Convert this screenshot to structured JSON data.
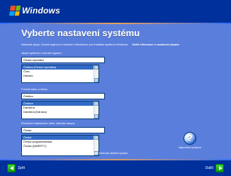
{
  "header": {
    "logo_text": "Windows"
  },
  "page": {
    "title": "Vyberte nastavení systému",
    "intro": "Nastavte jazyk, formát regionu a rozložení klávesnice pro instalaci systému Windows.",
    "intro_link": "Další informace o nastavení jazyka"
  },
  "sections": [
    {
      "label": "Jazyk systému a formát regionu:",
      "selected_value": "Česká republika",
      "list_items": [
        "Čeština (Česká republika)",
        "Čína",
        "Dánsko"
      ],
      "selected_index": 0
    },
    {
      "label": "Formát času a měny:",
      "selected_value": "Čeština",
      "list_items": [
        "Čeština",
        "Dánština",
        "Dánština (Dánsko)"
      ],
      "selected_index": 0
    },
    {
      "label": "Rozložení klávesnice nebo metoda vstupu:",
      "selected_value": "Česká",
      "list_items": [
        "Česká",
        "Česká programátorská",
        "Česká (QWERTY)"
      ],
      "selected_index": 0
    }
  ],
  "bottom_note": "Tato nastavení můžete později změnit v Ovládacích panelech v části Možnosti oblasti a jazyka.",
  "help": {
    "text": "Nápověda a podpora"
  },
  "footer": {
    "back_label": "Zpět",
    "next_label": "Další"
  }
}
